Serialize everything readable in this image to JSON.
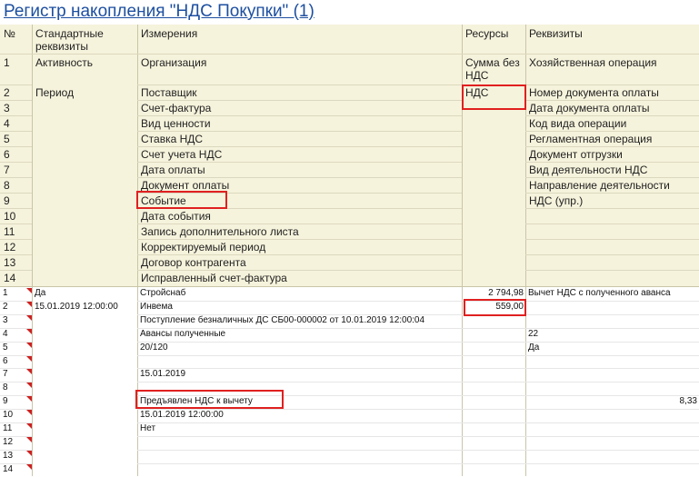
{
  "title": "Регистр накопления \"НДС Покупки\" (1)",
  "header": {
    "col_no": "№",
    "col_std": "Стандартные реквизиты",
    "col_dims": "Измерения",
    "col_res": "Ресурсы",
    "col_req": "Реквизиты",
    "rows": [
      {
        "n": "1",
        "std": "Активность",
        "dim": "Организация",
        "res": "Сумма без НДС",
        "req": "Хозяйственная операция"
      },
      {
        "n": "2",
        "std": "Период",
        "dim": "Поставщик",
        "res": "НДС",
        "req": "Номер документа оплаты"
      },
      {
        "n": "3",
        "std": "",
        "dim": "Счет-фактура",
        "res": "",
        "req": "Дата документа оплаты"
      },
      {
        "n": "4",
        "std": "",
        "dim": "Вид ценности",
        "res": "",
        "req": "Код вида операции"
      },
      {
        "n": "5",
        "std": "",
        "dim": "Ставка НДС",
        "res": "",
        "req": "Регламентная операция"
      },
      {
        "n": "6",
        "std": "",
        "dim": "Счет учета НДС",
        "res": "",
        "req": "Документ отгрузки"
      },
      {
        "n": "7",
        "std": "",
        "dim": "Дата оплаты",
        "res": "",
        "req": "Вид деятельности НДС"
      },
      {
        "n": "8",
        "std": "",
        "dim": "Документ оплаты",
        "res": "",
        "req": "Направление деятельности"
      },
      {
        "n": "9",
        "std": "",
        "dim": "Событие",
        "res": "",
        "req": "НДС (упр.)"
      },
      {
        "n": "10",
        "std": "",
        "dim": "Дата события",
        "res": "",
        "req": ""
      },
      {
        "n": "11",
        "std": "",
        "dim": "Запись дополнительного листа",
        "res": "",
        "req": ""
      },
      {
        "n": "12",
        "std": "",
        "dim": "Корректируемый период",
        "res": "",
        "req": ""
      },
      {
        "n": "13",
        "std": "",
        "dim": "Договор контрагента",
        "res": "",
        "req": ""
      },
      {
        "n": "14",
        "std": "",
        "dim": "Исправленный счет-фактура",
        "res": "",
        "req": ""
      }
    ]
  },
  "data": {
    "rows": [
      {
        "n": "1",
        "std": "Да",
        "dim": "Стройснаб",
        "res": "2 794,98",
        "req": "Вычет НДС с полученного аванса"
      },
      {
        "n": "2",
        "std": "15.01.2019 12:00:00",
        "dim": "Инвема",
        "res": "559,00",
        "req": ""
      },
      {
        "n": "3",
        "std": "",
        "dim": "Поступление безналичных ДС СБ00-000002 от 10.01.2019 12:00:04",
        "res": "",
        "req": ""
      },
      {
        "n": "4",
        "std": "",
        "dim": "Авансы полученные",
        "res": "",
        "req": "22"
      },
      {
        "n": "5",
        "std": "",
        "dim": "20/120",
        "res": "",
        "req": "Да"
      },
      {
        "n": "6",
        "std": "",
        "dim": "",
        "res": "",
        "req": ""
      },
      {
        "n": "7",
        "std": "",
        "dim": "15.01.2019",
        "res": "",
        "req": ""
      },
      {
        "n": "8",
        "std": "",
        "dim": "",
        "res": "",
        "req": ""
      },
      {
        "n": "9",
        "std": "",
        "dim": "Предъявлен НДС к вычету",
        "res": "",
        "req": "8,33"
      },
      {
        "n": "10",
        "std": "",
        "dim": "15.01.2019 12:00:00",
        "res": "",
        "req": ""
      },
      {
        "n": "11",
        "std": "",
        "dim": "Нет",
        "res": "",
        "req": ""
      },
      {
        "n": "12",
        "std": "",
        "dim": "",
        "res": "",
        "req": ""
      },
      {
        "n": "13",
        "std": "",
        "dim": "",
        "res": "",
        "req": ""
      },
      {
        "n": "14",
        "std": "",
        "dim": "",
        "res": "",
        "req": ""
      }
    ]
  }
}
